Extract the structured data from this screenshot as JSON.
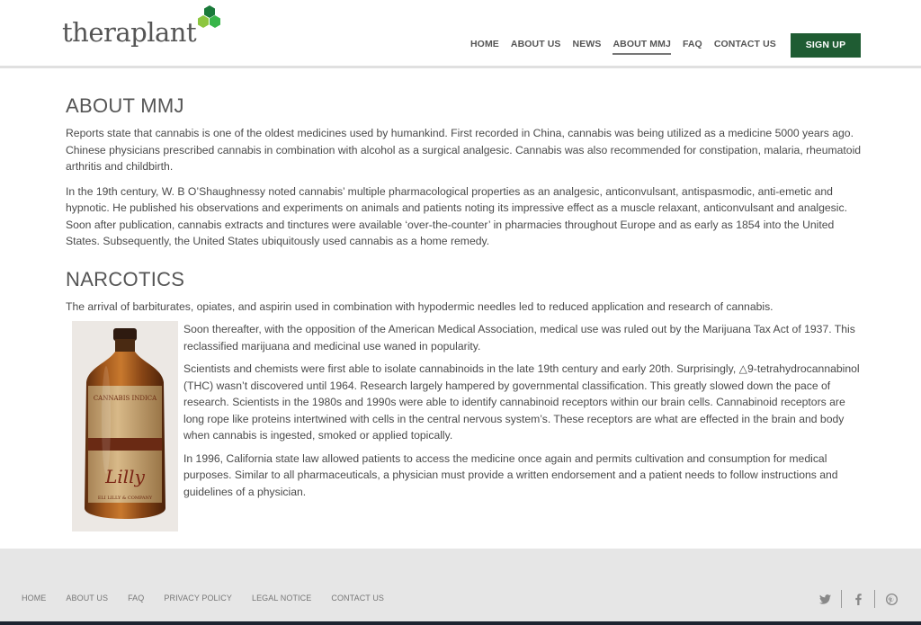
{
  "brand": {
    "name": "theraplant"
  },
  "nav": {
    "items": [
      {
        "label": "HOME",
        "active": false
      },
      {
        "label": "ABOUT US",
        "active": false
      },
      {
        "label": "NEWS",
        "active": false
      },
      {
        "label": "ABOUT MMJ",
        "active": true
      },
      {
        "label": "FAQ",
        "active": false
      },
      {
        "label": "CONTACT US",
        "active": false
      }
    ],
    "signup_label": "SIGN UP"
  },
  "main": {
    "about_heading": "ABOUT MMJ",
    "about_p1": "Reports state that cannabis is one of the oldest medicines used by humankind. First recorded in China, cannabis was being utilized as a medicine 5000 years ago. Chinese physicians prescribed cannabis in combination with alcohol as a surgical analgesic. Cannabis was also recommended for constipation, malaria, rheumatoid arthritis and childbirth.",
    "about_p2": "In the 19th century, W. B O’Shaughnessy noted cannabis’ multiple pharmacological properties as an analgesic, anticonvulsant, antispasmodic, anti-emetic and hypnotic. He published his observations and experiments on animals and patients noting its impressive effect as a muscle relaxant, anticonvulsant and analgesic. Soon after publication, cannabis extracts and tinctures were available ‘over-the-counter’ in pharmacies throughout Europe and as early as 1854 into the United States. Subsequently, the United States ubiquitously used cannabis as a home remedy.",
    "narcotics_heading": "NARCOTICS",
    "narcotics_p1": "The arrival of barbiturates, opiates, and aspirin used in combination with hypodermic needles led to reduced application and research of cannabis.",
    "narcotics_p2": "Soon thereafter, with the opposition of the American Medical Association, medical use was ruled out by the Marijuana Tax Act of 1937. This reclassified marijuana and medicinal use waned in popularity.",
    "narcotics_p3": "Scientists and chemists were first able to isolate cannabinoids in the late 19th century and early 20th. Surprisingly, △9-tetrahydrocannabinol (THC) wasn’t discovered until 1964. Research largely hampered by governmental classification. This greatly slowed down the pace of research. Scientists in the 1980s and 1990s were able to identify cannabinoid receptors within our brain cells. Cannabinoid receptors are long rope like proteins intertwined with cells in the central nervous system’s. These receptors are what are effected in the brain and body when cannabis is ingested, smoked or applied topically.",
    "narcotics_p4": "In 1996, California state law allowed patients to access the medicine once again and permits cultivation and consumption for medical purposes. Similar to all pharmaceuticals, a physician must provide a written endorsement and a patient needs to follow instructions and guidelines of a physician.",
    "bottle_label_top": "CANNABIS INDICA",
    "bottle_label_brand": "Lilly",
    "bottle_label_bottom": "ELI LILLY & COMPANY"
  },
  "footer": {
    "links": [
      "HOME",
      "ABOUT US",
      "FAQ",
      "PRIVACY POLICY",
      "LEGAL NOTICE",
      "CONTACT US"
    ],
    "social": [
      "twitter-icon",
      "facebook-icon",
      "pinterest-icon"
    ]
  },
  "colors": {
    "brand_green": "#1f5c33",
    "logo_green_light": "#8cc63f",
    "logo_green_mid": "#39b54a",
    "logo_green_dark": "#1a7a3a",
    "footer_bg": "#e6e6e6"
  }
}
